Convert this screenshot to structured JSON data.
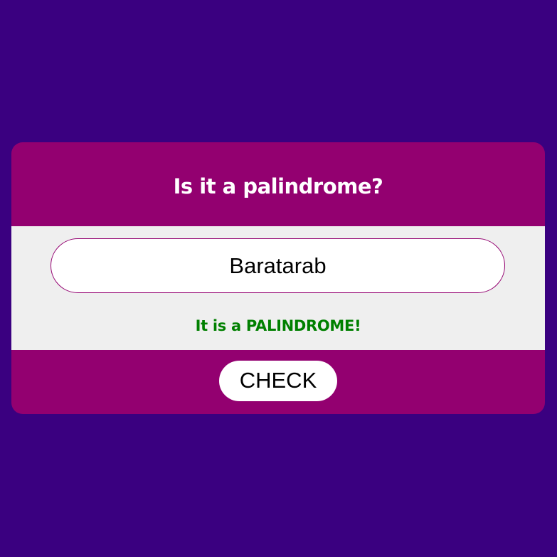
{
  "colors": {
    "page_background": "#3a0080",
    "card_accent": "#930070",
    "body_background": "#efefef",
    "result_text": "#008000",
    "button_background": "#ffffff"
  },
  "card": {
    "title": "Is it a palindrome?",
    "input": {
      "value": "Baratarab",
      "placeholder": ""
    },
    "result_text": "It is a PALINDROME!",
    "check_button_label": "CHECK"
  }
}
